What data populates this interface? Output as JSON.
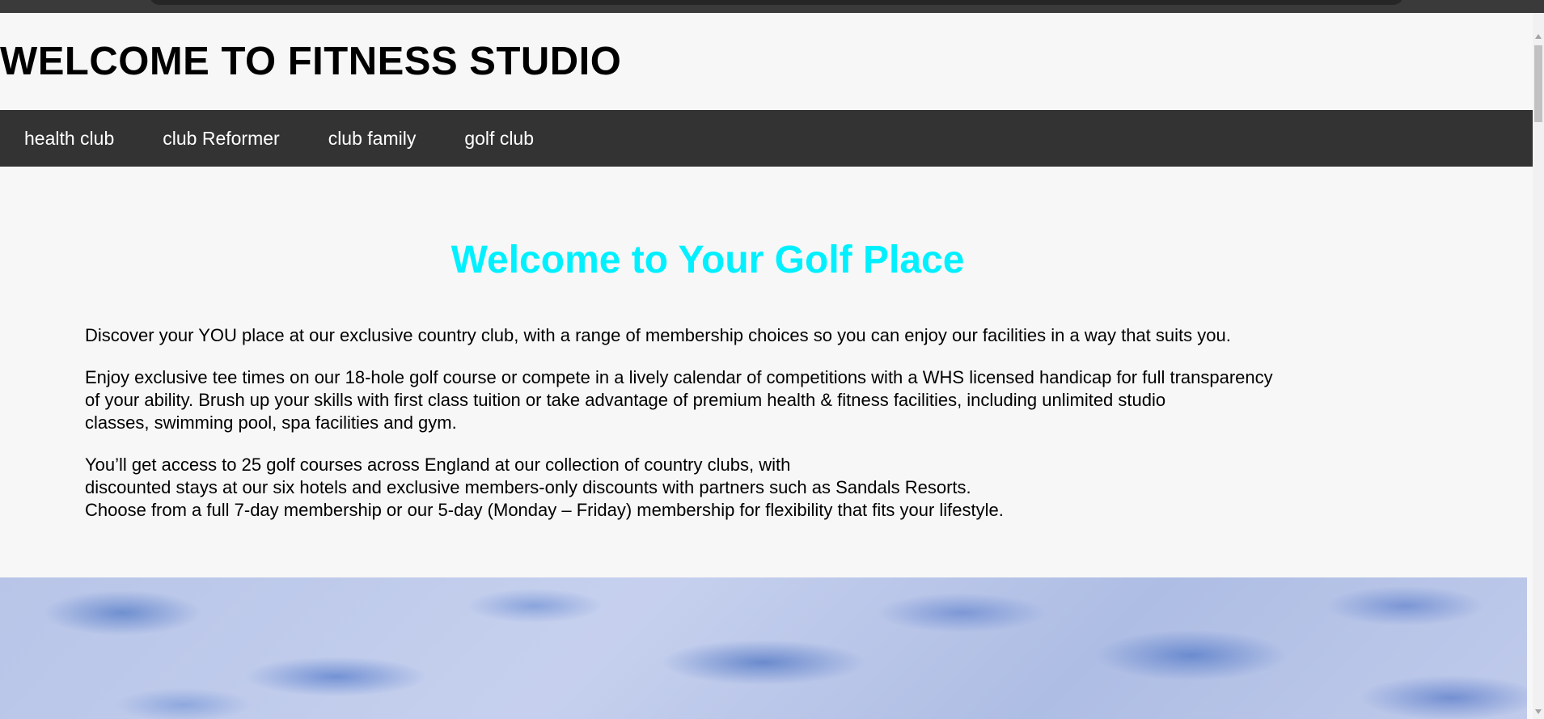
{
  "site": {
    "title": "WELCOME TO FITNESS STUDIO"
  },
  "nav": {
    "items": [
      {
        "label": "health club"
      },
      {
        "label": "club Reformer"
      },
      {
        "label": "club family"
      },
      {
        "label": "golf club"
      }
    ]
  },
  "hero": {
    "heading": "Welcome to Your Golf Place",
    "heading_color": "#00f0ff"
  },
  "content": {
    "paragraph1": "Discover your YOU place at our exclusive country club, with a range of membership choices so you can enjoy our facilities in a way that suits you.",
    "paragraph2_lines": [
      "Enjoy exclusive tee times on our 18-hole golf course or compete in a lively calendar of competitions with a WHS licensed handicap for full transparency",
      "of your ability. Brush up your skills with first class tuition or take advantage of premium health & fitness facilities, including unlimited studio",
      "classes, swimming pool, spa facilities and gym."
    ],
    "paragraph3_lines": [
      "You’ll get access to 25 golf courses across England at our collection of country clubs, with",
      "discounted stays at our six hotels and exclusive members-only discounts with partners such as Sandals Resorts.",
      "Choose from a full 7-day membership or our 5-day (Monday – Friday) membership for flexibility that fits your lifestyle."
    ]
  },
  "colors": {
    "nav_background": "#333333",
    "page_background": "#f7f7f7"
  }
}
